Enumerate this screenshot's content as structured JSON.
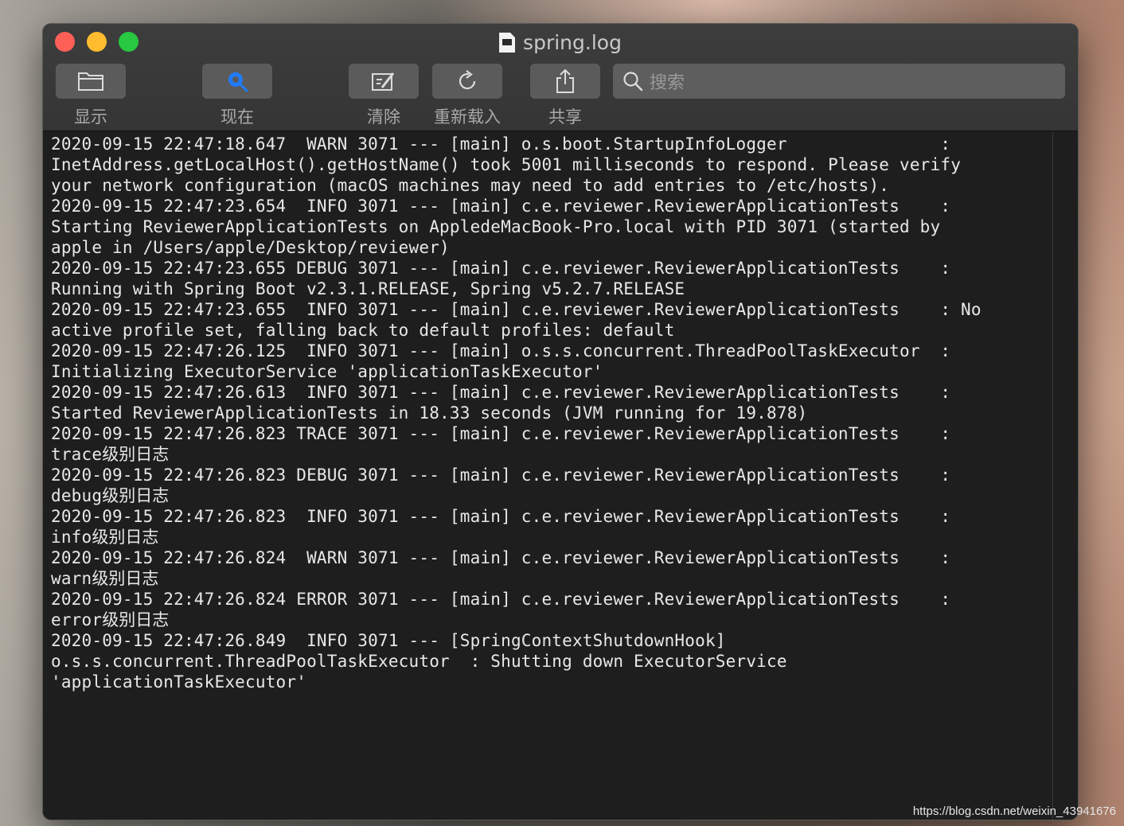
{
  "window": {
    "title": "spring.log"
  },
  "toolbar": {
    "show_label": "显示",
    "now_label": "现在",
    "clear_label": "清除",
    "reload_label": "重新载入",
    "share_label": "共享",
    "search_placeholder": "搜索",
    "icons": {
      "show": "folder-icon",
      "now": "magnify-now-icon",
      "clear": "clear-log-icon",
      "reload": "reload-icon",
      "share": "share-icon",
      "search": "search-icon"
    },
    "accent": "#1f7bff"
  },
  "log": {
    "lines": [
      "2020-09-15 22:47:18.647  WARN 3071 --- [main] o.s.boot.StartupInfoLogger               :",
      "InetAddress.getLocalHost().getHostName() took 5001 milliseconds to respond. Please verify",
      "your network configuration (macOS machines may need to add entries to /etc/hosts).",
      "2020-09-15 22:47:23.654  INFO 3071 --- [main] c.e.reviewer.ReviewerApplicationTests    :",
      "Starting ReviewerApplicationTests on AppledeMacBook-Pro.local with PID 3071 (started by",
      "apple in /Users/apple/Desktop/reviewer)",
      "2020-09-15 22:47:23.655 DEBUG 3071 --- [main] c.e.reviewer.ReviewerApplicationTests    :",
      "Running with Spring Boot v2.3.1.RELEASE, Spring v5.2.7.RELEASE",
      "2020-09-15 22:47:23.655  INFO 3071 --- [main] c.e.reviewer.ReviewerApplicationTests    : No",
      "active profile set, falling back to default profiles: default",
      "2020-09-15 22:47:26.125  INFO 3071 --- [main] o.s.s.concurrent.ThreadPoolTaskExecutor  :",
      "Initializing ExecutorService 'applicationTaskExecutor'",
      "2020-09-15 22:47:26.613  INFO 3071 --- [main] c.e.reviewer.ReviewerApplicationTests    :",
      "Started ReviewerApplicationTests in 18.33 seconds (JVM running for 19.878)",
      "2020-09-15 22:47:26.823 TRACE 3071 --- [main] c.e.reviewer.ReviewerApplicationTests    :",
      "trace级别日志",
      "2020-09-15 22:47:26.823 DEBUG 3071 --- [main] c.e.reviewer.ReviewerApplicationTests    :",
      "debug级别日志",
      "2020-09-15 22:47:26.823  INFO 3071 --- [main] c.e.reviewer.ReviewerApplicationTests    :",
      "info级别日志",
      "2020-09-15 22:47:26.824  WARN 3071 --- [main] c.e.reviewer.ReviewerApplicationTests    :",
      "warn级别日志",
      "2020-09-15 22:47:26.824 ERROR 3071 --- [main] c.e.reviewer.ReviewerApplicationTests    :",
      "error级别日志",
      "2020-09-15 22:47:26.849  INFO 3071 --- [SpringContextShutdownHook]",
      "o.s.s.concurrent.ThreadPoolTaskExecutor  : Shutting down ExecutorService",
      "'applicationTaskExecutor'"
    ]
  },
  "watermark": "https://blog.csdn.net/weixin_43941676"
}
